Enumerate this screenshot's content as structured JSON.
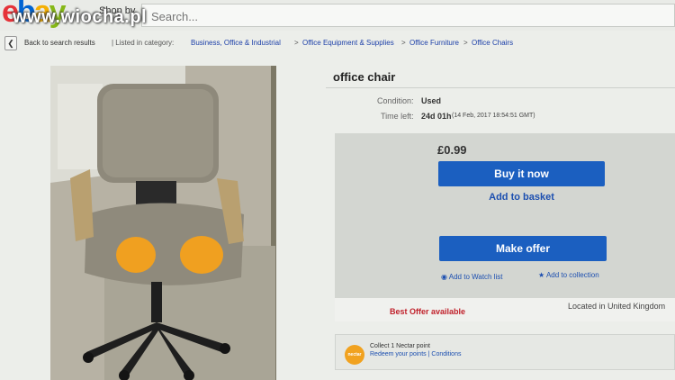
{
  "header": {
    "logo_letters": [
      {
        "char": "e",
        "color": "#e53238"
      },
      {
        "char": "b",
        "color": "#0064d2"
      },
      {
        "char": "a",
        "color": "#f5af02"
      },
      {
        "char": "y",
        "color": "#86b817"
      }
    ],
    "shop_by": "Shop by",
    "search_placeholder": "Search...",
    "watermark": "www.wiocha.pl"
  },
  "breadcrumb": {
    "back_icon": "chevron-left-icon",
    "back_label": "Back to search results",
    "listed_label": "| Listed in category:",
    "categories": [
      "Business, Office & Industrial",
      "Office Equipment & Supplies",
      "Office Furniture",
      "Office Chairs"
    ],
    "separator": ">"
  },
  "item": {
    "title": "office chair",
    "condition_label": "Condition:",
    "condition_value": "Used",
    "time_left_label": "Time left:",
    "time_left_value": "24d 01h",
    "time_left_date": "(14 Feb, 2017   18:54:51 GMT)"
  },
  "buy_box": {
    "price": "£0.99",
    "buy_now": "Buy it now",
    "add_to_basket": "Add to basket",
    "make_offer": "Make offer",
    "watch_icon": "eye-icon",
    "add_to_watch": "Add to Watch list",
    "collection_icon": "star-icon",
    "add_to_collection": "Add to collection"
  },
  "offer": {
    "best_offer": "Best Offer available",
    "location": "Located in United Kingdom"
  },
  "nectar": {
    "logo_text": "nectar",
    "line1": "Collect 1 Nectar point",
    "redeem": "Redeem your points",
    "divider": "|",
    "conditions": "Conditions"
  },
  "colors": {
    "accent_blue": "#1b5fc0",
    "link_blue": "#1c4fb0",
    "best_offer_red": "#c0202a",
    "seat_foam_orange": "#f0a020"
  }
}
